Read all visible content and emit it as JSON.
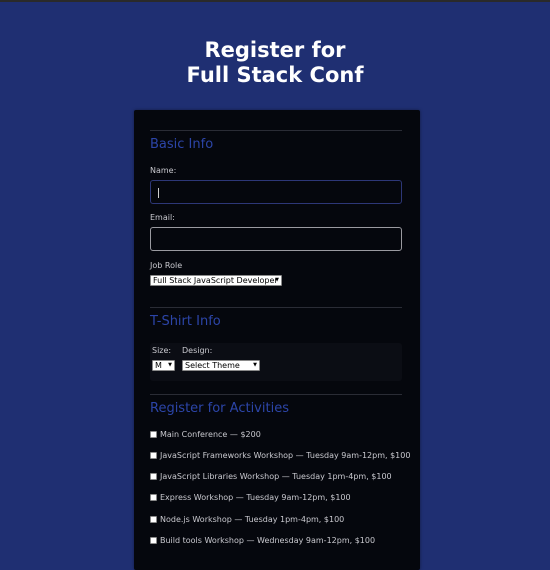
{
  "page": {
    "title_line1": "Register for",
    "title_line2": "Full Stack Conf"
  },
  "basic_info": {
    "title": "Basic Info",
    "name_label": "Name:",
    "name_value": "",
    "email_label": "Email:",
    "email_value": "",
    "job_role_label": "Job Role",
    "job_role_selected": "Full Stack JavaScript Developer"
  },
  "tshirt_info": {
    "title": "T-Shirt Info",
    "size_label": "Size:",
    "size_selected": "M",
    "design_label": "Design:",
    "design_selected": "Select Theme"
  },
  "activities": {
    "title": "Register for Activities",
    "items": [
      {
        "label": "Main Conference — $200",
        "checked": false
      },
      {
        "label": "JavaScript Frameworks Workshop — Tuesday 9am-12pm, $100",
        "checked": false
      },
      {
        "label": "JavaScript Libraries Workshop — Tuesday 1pm-4pm, $100",
        "checked": false
      },
      {
        "label": "Express Workshop — Tuesday 9am-12pm, $100",
        "checked": false
      },
      {
        "label": "Node.js Workshop — Tuesday 1pm-4pm, $100",
        "checked": false
      },
      {
        "label": "Build tools Workshop — Wednesday 9am-12pm, $100",
        "checked": false
      }
    ]
  },
  "colors": {
    "page_background": "#1f2f72",
    "form_background": "#05070d",
    "section_title": "#2c45a8"
  },
  "icons": {
    "select_arrow": "dropdown-arrow-icon",
    "checkbox": "checkbox-icon"
  }
}
